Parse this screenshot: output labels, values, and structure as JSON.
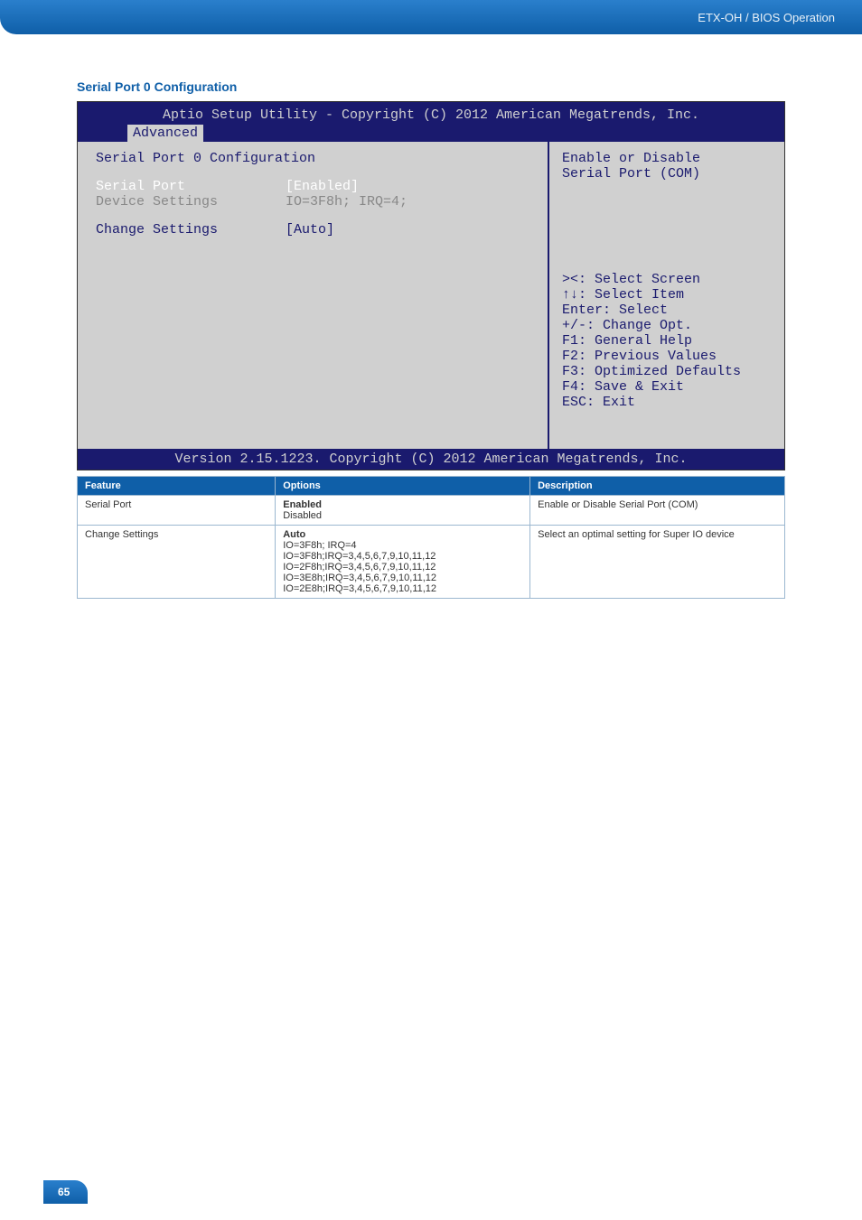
{
  "header": {
    "breadcrumb": "ETX-OH / BIOS Operation"
  },
  "section": {
    "title": "Serial Port 0 Configuration"
  },
  "bios": {
    "title": "Aptio Setup Utility - Copyright (C) 2012 American Megatrends, Inc.",
    "tab": "Advanced",
    "heading": "Serial Port 0 Configuration",
    "rows": {
      "serial_port_label": "Serial Port",
      "serial_port_value": "[Enabled]",
      "device_settings_label": "Device Settings",
      "device_settings_value": "IO=3F8h; IRQ=4;",
      "change_settings_label": "Change Settings",
      "change_settings_value": "[Auto]"
    },
    "help_top1": "Enable or Disable",
    "help_top2": "Serial Port (COM)",
    "nav": {
      "l1": "><: Select Screen",
      "l2": "↑↓: Select Item",
      "l3": "Enter: Select",
      "l4": "+/-: Change Opt.",
      "l5": "F1: General Help",
      "l6": "F2: Previous Values",
      "l7": "F3: Optimized Defaults",
      "l8": "F4: Save & Exit",
      "l9": "ESC: Exit"
    },
    "footer": "Version 2.15.1223. Copyright (C) 2012 American Megatrends, Inc."
  },
  "table": {
    "headers": {
      "feature": "Feature",
      "options": "Options",
      "description": "Description"
    },
    "rows": [
      {
        "feature": "Serial Port",
        "options_default": "Enabled",
        "options_rest": [
          "Disabled"
        ],
        "description": "Enable or Disable Serial Port (COM)"
      },
      {
        "feature": "Change Settings",
        "options_default": "Auto",
        "options_rest": [
          "IO=3F8h; IRQ=4",
          "IO=3F8h;IRQ=3,4,5,6,7,9,10,11,12",
          "IO=2F8h;IRQ=3,4,5,6,7,9,10,11,12",
          "IO=3E8h;IRQ=3,4,5,6,7,9,10,11,12",
          "IO=2E8h;IRQ=3,4,5,6,7,9,10,11,12"
        ],
        "description": "Select an optimal setting for Super IO device"
      }
    ]
  },
  "page_number": "65"
}
